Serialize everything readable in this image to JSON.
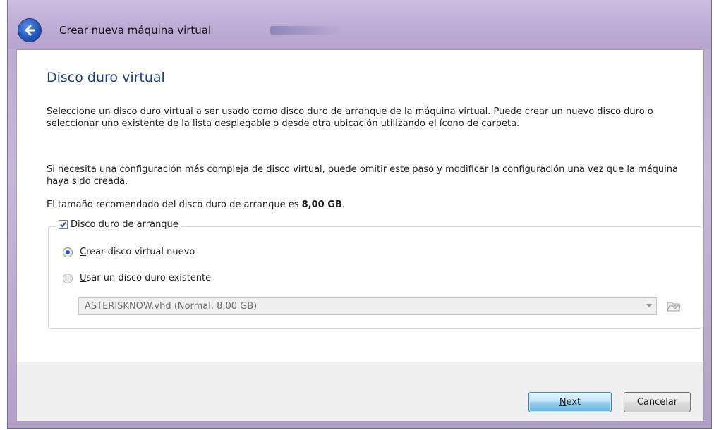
{
  "window": {
    "title": "Crear nueva máquina virtual"
  },
  "page": {
    "heading": "Disco duro virtual",
    "para1": "Seleccione un disco duro virtual a ser usado como disco duro de arranque de la máquina virtual. Puede crear un nuevo disco duro o seleccionar uno existente de la lista desplegable o desde otra ubicación utilizando el ícono de carpeta.",
    "para2": "Si necesita una configuración más compleja de disco virtual, puede omitir este paso y modificar la configuración una vez que la máquina haya sido creada.",
    "recommended_prefix": "El tamaño recomendado del disco duro de arranque es ",
    "recommended_size": "8,00 GB",
    "recommended_suffix": "."
  },
  "boot_disk_group": {
    "checkbox_label_pre": "Disco ",
    "checkbox_label_mnemonic": "d",
    "checkbox_label_post": "uro de arranque",
    "checked": true,
    "option_create": {
      "mnemonic": "C",
      "rest": "rear disco virtual nuevo",
      "selected": true
    },
    "option_existing": {
      "mnemonic": "U",
      "rest": "sar un disco duro existente",
      "selected": false
    },
    "existing_disk_value": "ASTERISKNOW.vhd (Normal, 8,00 GB)"
  },
  "buttons": {
    "next_mnemonic": "N",
    "next_rest": "ext",
    "cancel": "Cancelar"
  },
  "icons": {
    "back": "back-arrow-icon",
    "checkmark": "checkmark-icon",
    "dropdown": "chevron-down-icon",
    "folder": "folder-icon"
  },
  "colors": {
    "heading": "#1a3e8c",
    "titlebar": "#bfaed6",
    "radio_dot": "#1e56c1",
    "primary_button": "#98d1ef"
  }
}
